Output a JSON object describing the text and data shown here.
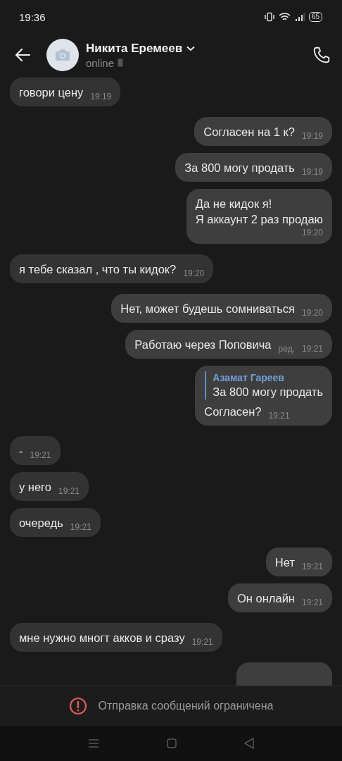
{
  "status_bar": {
    "time": "19:36",
    "battery": "65"
  },
  "header": {
    "name": "Никита Еремеев",
    "status": "online"
  },
  "messages": [
    {
      "kind": "incoming",
      "lines": [
        "говори цену"
      ],
      "time": "19:19"
    },
    {
      "kind": "outgoing",
      "lines": [
        "Согласен на 1 к?"
      ],
      "time": "19:19"
    },
    {
      "kind": "outgoing",
      "lines": [
        "За 800 могу продать"
      ],
      "time": "19:19"
    },
    {
      "kind": "outgoing",
      "lines": [
        "Да не кидок я!",
        "Я аккаунт 2 раз продаю"
      ],
      "time": "19:20"
    },
    {
      "kind": "incoming",
      "lines": [
        "я тебе сказал , что ты кидок?"
      ],
      "time": "19:20"
    },
    {
      "kind": "outgoing",
      "lines": [
        "Нет, может будешь сомниваться"
      ],
      "time": "19:20"
    },
    {
      "kind": "outgoing",
      "lines": [
        "Работаю через Поповича"
      ],
      "edited": "ред.",
      "time": "19:21"
    },
    {
      "kind": "outgoing",
      "reply": {
        "author": "Азамат Гареев",
        "text": "За 800 могу продать"
      },
      "lines": [
        "Согласен?"
      ],
      "time": "19:21"
    },
    {
      "kind": "incoming",
      "lines": [
        "-"
      ],
      "time": "19:21"
    },
    {
      "kind": "incoming",
      "lines": [
        "у него"
      ],
      "time": "19:21"
    },
    {
      "kind": "incoming",
      "lines": [
        "очередь"
      ],
      "time": "19:21"
    },
    {
      "kind": "outgoing",
      "lines": [
        "Нет"
      ],
      "time": "19:21"
    },
    {
      "kind": "outgoing",
      "lines": [
        "Он онлайн"
      ],
      "time": "19:21"
    },
    {
      "kind": "incoming",
      "lines": [
        "мне нужно многт акков и сразу"
      ],
      "time": "19:21"
    },
    {
      "kind": "outgoing"
    }
  ],
  "footer": {
    "notice": "Отправка сообщений ограничена"
  }
}
